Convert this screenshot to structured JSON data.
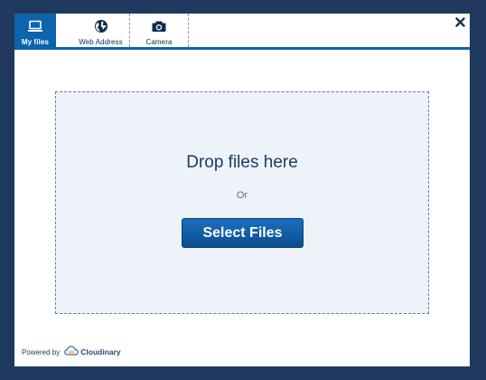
{
  "tabs": [
    {
      "label": "My files",
      "icon": "laptop-icon",
      "active": true
    },
    {
      "label": "Web Address",
      "icon": "globe-icon",
      "active": false
    },
    {
      "label": "Camera",
      "icon": "camera-icon",
      "active": false
    }
  ],
  "close": {
    "icon": "close-icon"
  },
  "dropzone": {
    "title": "Drop files here",
    "or_text": "Or",
    "select_button": "Select Files"
  },
  "footer": {
    "powered_by": "Powered by",
    "brand_name": "Cloudinary",
    "brand_icon": "cloudinary-logo-icon"
  },
  "colors": {
    "backdrop": "#1f3a5e",
    "accent": "#0b64ad",
    "dropzone_bg": "#eef2f9",
    "title_text": "#1a3d62"
  }
}
